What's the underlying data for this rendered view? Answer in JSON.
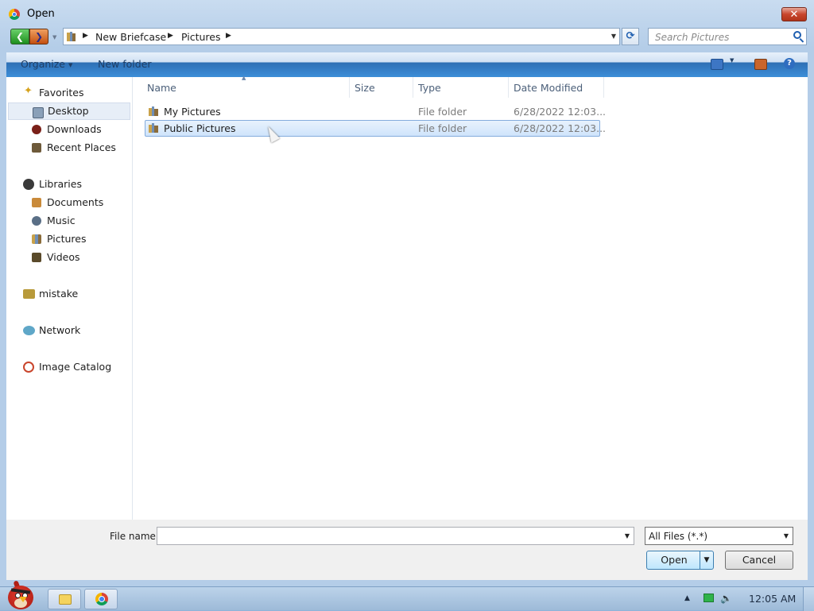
{
  "window": {
    "title": "Open",
    "close_glyph": "✕"
  },
  "nav_buttons": {
    "back_glyph": "❮",
    "forward_glyph": "❯"
  },
  "address": {
    "crumbs": [
      "New Briefcase",
      "Pictures"
    ],
    "separator_glyph": "▶"
  },
  "search": {
    "placeholder": "Search Pictures"
  },
  "toolbar": {
    "organize_label": "Organize",
    "new_folder_label": "New folder"
  },
  "sidebar": {
    "favorites": {
      "label": "Favorites"
    },
    "items_favorites": [
      "Desktop",
      "Downloads",
      "Recent Places"
    ],
    "libraries": {
      "label": "Libraries"
    },
    "items_libraries": [
      "Documents",
      "Music",
      "Pictures",
      "Videos"
    ],
    "homegroup": {
      "label": "mistake"
    },
    "network": {
      "label": "Network"
    },
    "catalog": {
      "label": "Image Catalog"
    }
  },
  "columns": {
    "name": "Name",
    "size": "Size",
    "type": "Type",
    "date": "Date Modified"
  },
  "files": [
    {
      "name": "My Pictures",
      "type": "File folder",
      "date": "6/28/2022 12:03...",
      "selected": false
    },
    {
      "name": "Public Pictures",
      "type": "File folder",
      "date": "6/28/2022 12:03...",
      "selected": true
    }
  ],
  "bottom": {
    "file_name_label": "File name:",
    "file_name_value": "",
    "filter_value": "All Files (*.*)",
    "open_label": "Open",
    "cancel_label": "Cancel"
  },
  "taskbar": {
    "clock": "12:05 AM"
  },
  "colors": {
    "accent": "#2d6fb5",
    "selection": "#cfe4fb"
  }
}
